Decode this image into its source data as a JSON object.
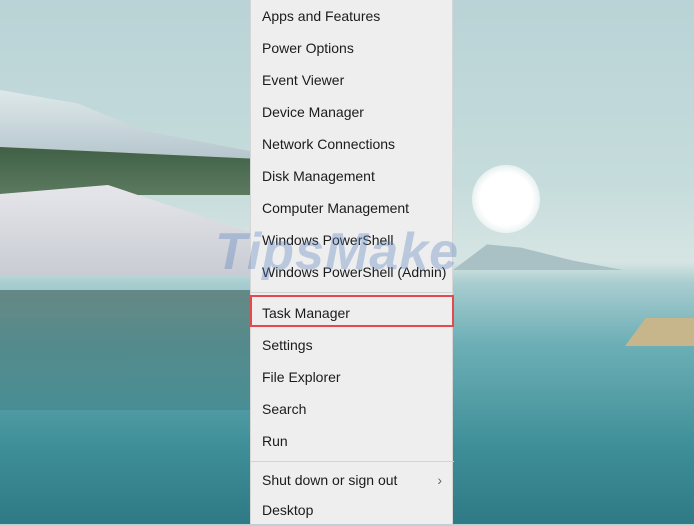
{
  "menu": {
    "items": [
      {
        "label": "Apps and Features"
      },
      {
        "label": "Power Options"
      },
      {
        "label": "Event Viewer"
      },
      {
        "label": "Device Manager"
      },
      {
        "label": "Network Connections"
      },
      {
        "label": "Disk Management"
      },
      {
        "label": "Computer Management"
      },
      {
        "label": "Windows PowerShell"
      },
      {
        "label": "Windows PowerShell (Admin)"
      },
      {
        "label": "Task Manager"
      },
      {
        "label": "Settings"
      },
      {
        "label": "File Explorer"
      },
      {
        "label": "Search"
      },
      {
        "label": "Run"
      },
      {
        "label": "Shut down or sign out"
      },
      {
        "label": "Desktop"
      }
    ],
    "highlighted": "Task Manager",
    "highlight_color": "#e8474b"
  },
  "watermark": "TipsMake"
}
